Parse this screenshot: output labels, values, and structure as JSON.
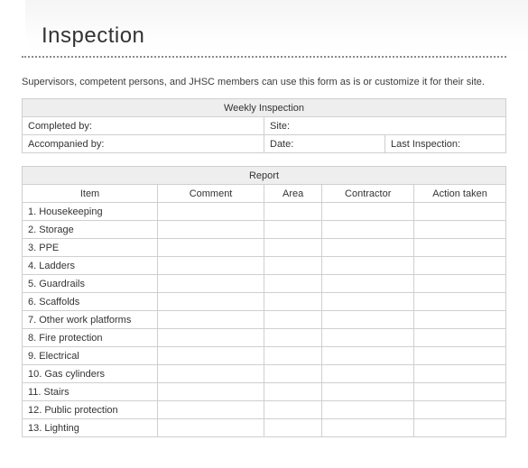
{
  "title": "Inspection",
  "intro": "Supervisors, competent persons, and JHSC members can use this form as is or customize it for their site.",
  "weekly": {
    "header": "Weekly Inspection",
    "completed_by_label": "Completed by:",
    "completed_by_value": "",
    "site_label": "Site:",
    "site_value": "",
    "accompanied_by_label": "Accompanied by:",
    "accompanied_by_value": "",
    "date_label": "Date:",
    "date_value": "",
    "last_inspection_label": "Last Inspection:",
    "last_inspection_value": ""
  },
  "report": {
    "header": "Report",
    "columns": {
      "item": "Item",
      "comment": "Comment",
      "area": "Area",
      "contractor": "Contractor",
      "action": "Action taken"
    },
    "rows": [
      {
        "item": "1. Housekeeping",
        "comment": "",
        "area": "",
        "contractor": "",
        "action": ""
      },
      {
        "item": "2. Storage",
        "comment": "",
        "area": "",
        "contractor": "",
        "action": ""
      },
      {
        "item": "3. PPE",
        "comment": "",
        "area": "",
        "contractor": "",
        "action": ""
      },
      {
        "item": "4. Ladders",
        "comment": "",
        "area": "",
        "contractor": "",
        "action": ""
      },
      {
        "item": "5. Guardrails",
        "comment": "",
        "area": "",
        "contractor": "",
        "action": ""
      },
      {
        "item": "6. Scaffolds",
        "comment": "",
        "area": "",
        "contractor": "",
        "action": ""
      },
      {
        "item": "7. Other work platforms",
        "comment": "",
        "area": "",
        "contractor": "",
        "action": ""
      },
      {
        "item": "8. Fire protection",
        "comment": "",
        "area": "",
        "contractor": "",
        "action": ""
      },
      {
        "item": "9. Electrical",
        "comment": "",
        "area": "",
        "contractor": "",
        "action": ""
      },
      {
        "item": "10. Gas cylinders",
        "comment": "",
        "area": "",
        "contractor": "",
        "action": ""
      },
      {
        "item": "11. Stairs",
        "comment": "",
        "area": "",
        "contractor": "",
        "action": ""
      },
      {
        "item": "12. Public protection",
        "comment": "",
        "area": "",
        "contractor": "",
        "action": ""
      },
      {
        "item": "13. Lighting",
        "comment": "",
        "area": "",
        "contractor": "",
        "action": ""
      }
    ]
  }
}
